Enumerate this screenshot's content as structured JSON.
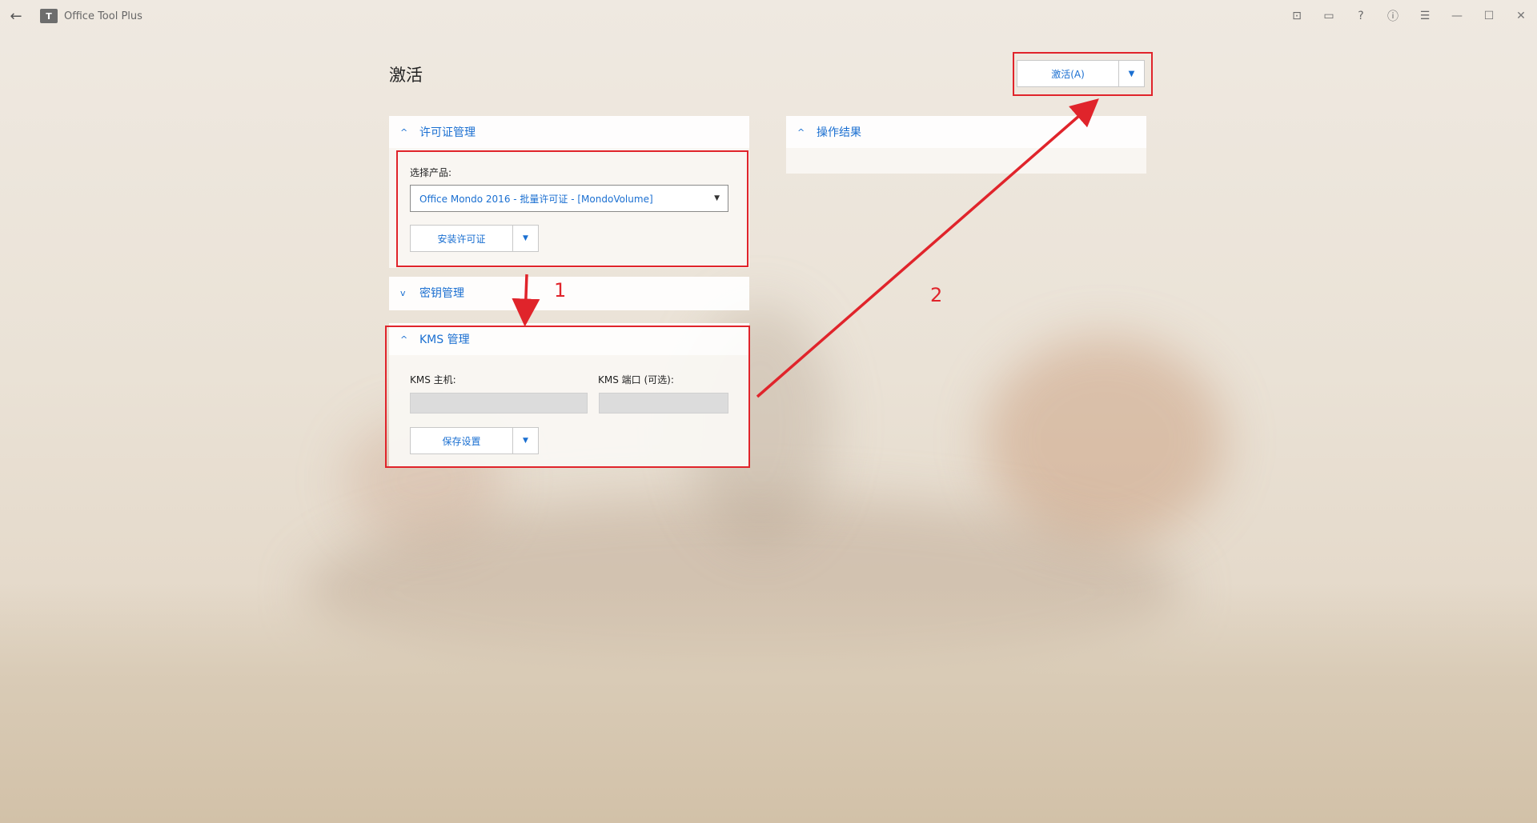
{
  "app": {
    "title": "Office Tool Plus",
    "logo_text": "T"
  },
  "titlebar": {
    "tools": [
      {
        "name": "terminal-icon",
        "glyph": "⊡"
      },
      {
        "name": "feedback-icon",
        "glyph": "▭"
      },
      {
        "name": "help-icon",
        "glyph": "?"
      },
      {
        "name": "info-icon",
        "glyph": "ⓘ"
      },
      {
        "name": "settings-sliders-icon",
        "glyph": "☰"
      }
    ],
    "window": {
      "minimize": "—",
      "maximize": "☐",
      "close": "✕"
    }
  },
  "page": {
    "title": "激活",
    "activate_button": "激活(A)",
    "dropdown_glyph": "▼"
  },
  "license_panel": {
    "header": "许可证管理",
    "chevron": "^",
    "product_label": "选择产品:",
    "product_value": "Office Mondo 2016 - 批量许可证 - [MondoVolume]",
    "install_button": "安装许可证"
  },
  "key_panel": {
    "header": "密钥管理",
    "chevron": "v"
  },
  "kms_panel": {
    "header": "KMS 管理",
    "chevron": "^",
    "host_label": "KMS 主机:",
    "port_label": "KMS 端口 (可选):",
    "host_value": "",
    "port_value": "",
    "save_button": "保存设置"
  },
  "result_panel": {
    "header": "操作结果",
    "chevron": "^"
  },
  "annotations": {
    "step1": "1",
    "step2": "2",
    "color": "#e0242b"
  }
}
